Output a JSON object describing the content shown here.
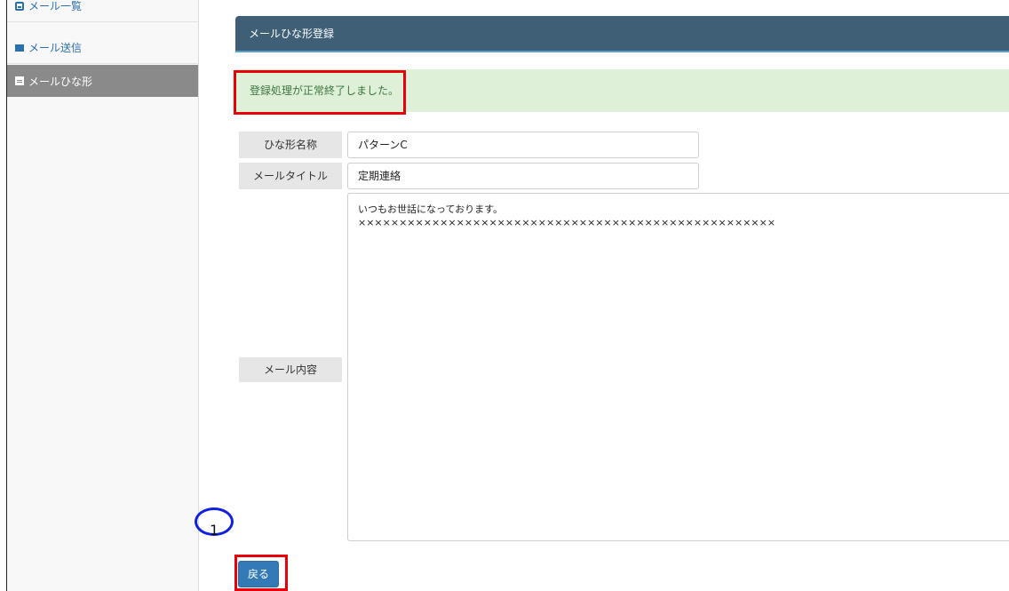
{
  "sidebar": {
    "items": [
      {
        "label": "メール一覧",
        "icon": "inbox-icon"
      },
      {
        "label": "メール送信",
        "icon": "mail-icon"
      },
      {
        "label": "メールひな形",
        "icon": "file-icon",
        "active": true
      }
    ]
  },
  "panel": {
    "title": "メールひな形登録"
  },
  "alert": {
    "message": "登録処理が正常終了しました。"
  },
  "form": {
    "template_name_label": "ひな形名称",
    "template_name_value": "パターンC",
    "mail_title_label": "メールタイトル",
    "mail_title_value": "定期連絡",
    "mail_body_label": "メール内容",
    "mail_body_lines": [
      "いつもお世話になっております。",
      "×××××××××××××××××××××××××××××××××××××××××××××××××××"
    ]
  },
  "annotation": {
    "step_number": "1"
  },
  "actions": {
    "back_label": "戻る"
  },
  "colors": {
    "header": "#3e5f76",
    "alert_bg": "#dff0d8",
    "alert_text": "#3c763d",
    "highlight": "#e8000b",
    "button": "#337ab7"
  }
}
